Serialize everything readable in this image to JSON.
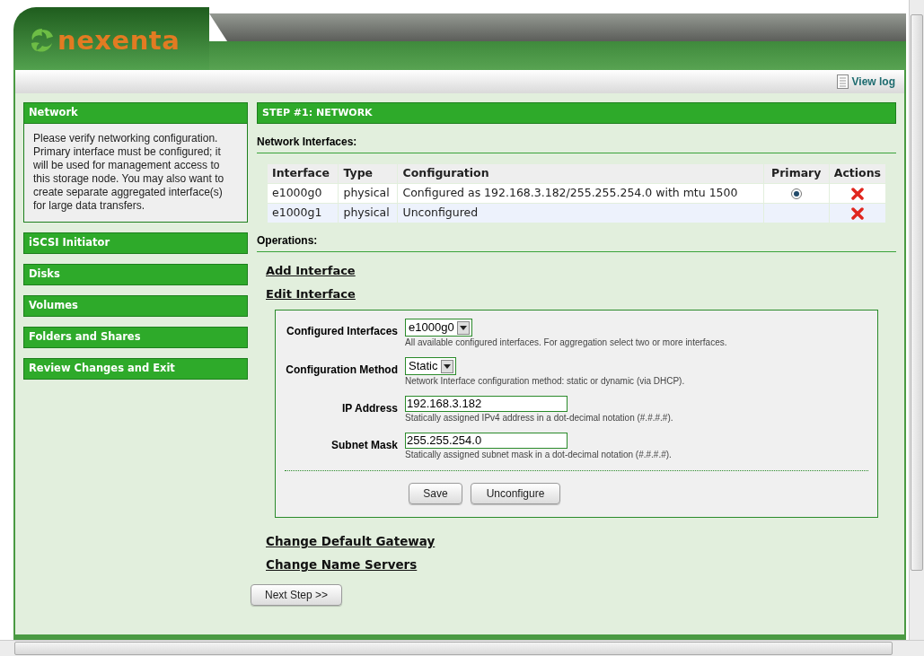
{
  "logo": {
    "text": "nexenta"
  },
  "toolbar": {
    "link": "View log"
  },
  "sidebar": {
    "sections": [
      {
        "title": "Network",
        "description": "Please verify networking configuration. Primary interface must be configured; it will be used for management access to this storage node. You may also want to create separate aggregated interface(s) for large data transfers."
      },
      {
        "title": "iSCSI Initiator"
      },
      {
        "title": "Disks"
      },
      {
        "title": "Volumes"
      },
      {
        "title": "Folders and Shares"
      },
      {
        "title": "Review Changes and Exit"
      }
    ]
  },
  "step": {
    "title": "STEP #1: NETWORK"
  },
  "interfaces": {
    "heading": "Network Interfaces:",
    "columns": [
      "Interface",
      "Type",
      "Configuration",
      "Primary",
      "Actions"
    ],
    "rows": [
      {
        "interface": "e1000g0",
        "type": "physical",
        "configuration": "Configured as 192.168.3.182/255.255.254.0 with mtu 1500",
        "primary": true
      },
      {
        "interface": "e1000g1",
        "type": "physical",
        "configuration": "Unconfigured",
        "primary": false
      }
    ]
  },
  "operations": {
    "heading": "Operations:",
    "links_top": [
      "Add Interface",
      "Edit Interface"
    ],
    "form": {
      "fields": [
        {
          "kind": "select",
          "label": "Configured Interfaces",
          "value": "e1000g0",
          "hint": "All available configured interfaces. For aggregation select two or more interfaces."
        },
        {
          "kind": "select",
          "label": "Configuration Method",
          "value": "Static",
          "hint": "Network Interface configuration method: static or dynamic (via DHCP)."
        },
        {
          "kind": "text",
          "label": "IP Address",
          "value": "192.168.3.182",
          "hint": "Statically assigned IPv4 address in a dot-decimal notation (#.#.#.#)."
        },
        {
          "kind": "text",
          "label": "Subnet Mask",
          "value": "255.255.254.0",
          "hint": "Statically assigned subnet mask in a dot-decimal notation (#.#.#.#)."
        }
      ],
      "buttons": [
        "Save",
        "Unconfigure"
      ]
    },
    "links_bottom": [
      "Change Default Gateway",
      "Change Name Servers"
    ]
  },
  "next_button": "Next Step >>"
}
